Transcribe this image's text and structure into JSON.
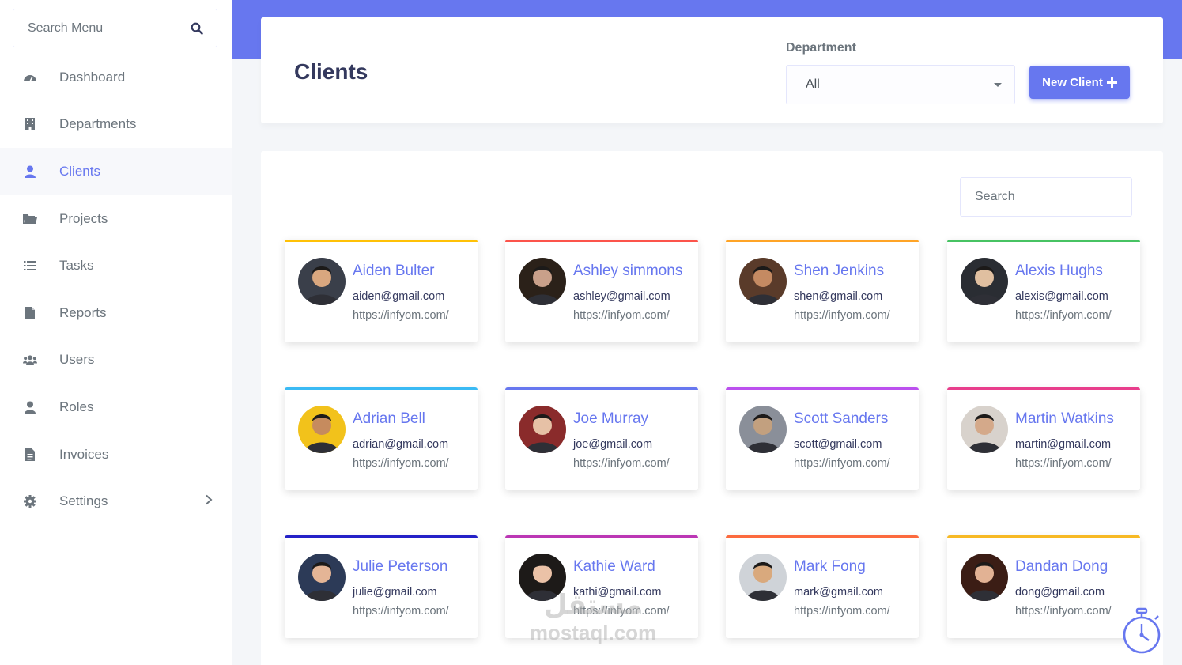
{
  "sidebar": {
    "search_placeholder": "Search Menu",
    "items": [
      {
        "label": "Dashboard",
        "icon": "dashboard-icon"
      },
      {
        "label": "Departments",
        "icon": "building-icon"
      },
      {
        "label": "Clients",
        "icon": "user-icon",
        "active": true
      },
      {
        "label": "Projects",
        "icon": "folder-icon"
      },
      {
        "label": "Tasks",
        "icon": "list-icon"
      },
      {
        "label": "Reports",
        "icon": "file-icon"
      },
      {
        "label": "Users",
        "icon": "users-icon"
      },
      {
        "label": "Roles",
        "icon": "user-icon"
      },
      {
        "label": "Invoices",
        "icon": "invoice-icon"
      },
      {
        "label": "Settings",
        "icon": "gear-icon"
      }
    ]
  },
  "header": {
    "title": "Clients",
    "department_label": "Department",
    "department_value": "All",
    "new_client_label": "New Client"
  },
  "main": {
    "search_placeholder": "Search"
  },
  "colors": {
    "accent": "#6777ef",
    "sidebar_bg": "#ffffff",
    "page_bg": "#f4f6f9"
  },
  "clients": [
    {
      "name": "Aiden Bulter",
      "email": "aiden@gmail.com",
      "url": "https://infyom.com/",
      "accent": "#ffc107",
      "avatar_bg": "#3a3f4a",
      "avatar_skin": "#d9a77f"
    },
    {
      "name": "Ashley simmons",
      "email": "ashley@gmail.com",
      "url": "https://infyom.com/",
      "accent": "#fc544b",
      "avatar_bg": "#2b2119",
      "avatar_skin": "#c9a08a"
    },
    {
      "name": "Shen Jenkins",
      "email": "shen@gmail.com",
      "url": "https://infyom.com/",
      "accent": "#ffa426",
      "avatar_bg": "#5a3b2a",
      "avatar_skin": "#c48a62"
    },
    {
      "name": "Alexis Hughs",
      "email": "alexis@gmail.com",
      "url": "https://infyom.com/",
      "accent": "#47c363",
      "avatar_bg": "#2a2d33",
      "avatar_skin": "#e0bfa0"
    },
    {
      "name": "Adrian Bell",
      "email": "adrian@gmail.com",
      "url": "https://infyom.com/",
      "accent": "#3abaf4",
      "avatar_bg": "#f2c21b",
      "avatar_skin": "#c68b5e"
    },
    {
      "name": "Joe Murray",
      "email": "joe@gmail.com",
      "url": "https://infyom.com/",
      "accent": "#6777ef",
      "avatar_bg": "#8a2b2b",
      "avatar_skin": "#e6c1a6"
    },
    {
      "name": "Scott Sanders",
      "email": "scott@gmail.com",
      "url": "https://infyom.com/",
      "accent": "#bb50ee",
      "avatar_bg": "#8a8f99",
      "avatar_skin": "#c2a07f"
    },
    {
      "name": "Martin Watkins",
      "email": "martin@gmail.com",
      "url": "https://infyom.com/",
      "accent": "#e83e8c",
      "avatar_bg": "#d8d2cc",
      "avatar_skin": "#d4a98a"
    },
    {
      "name": "Julie Peterson",
      "email": "julie@gmail.com",
      "url": "https://infyom.com/",
      "accent": "#2421c7",
      "avatar_bg": "#2c3a57",
      "avatar_skin": "#e4b596"
    },
    {
      "name": "Kathie Ward",
      "email": "kathi@gmail.com",
      "url": "https://infyom.com/",
      "accent": "#bb36b4",
      "avatar_bg": "#1d1a18",
      "avatar_skin": "#ebc2a7"
    },
    {
      "name": "Mark Fong",
      "email": "mark@gmail.com",
      "url": "https://infyom.com/",
      "accent": "#fc6a3e",
      "avatar_bg": "#cfd3d8",
      "avatar_skin": "#d9a97d"
    },
    {
      "name": "Dandan Dong",
      "email": "dong@gmail.com",
      "url": "https://infyom.com/",
      "accent": "#f7b924",
      "avatar_bg": "#3b1d15",
      "avatar_skin": "#e2b294"
    }
  ],
  "watermark": {
    "arabic": "مستقل",
    "latin": "mostaql.com"
  }
}
